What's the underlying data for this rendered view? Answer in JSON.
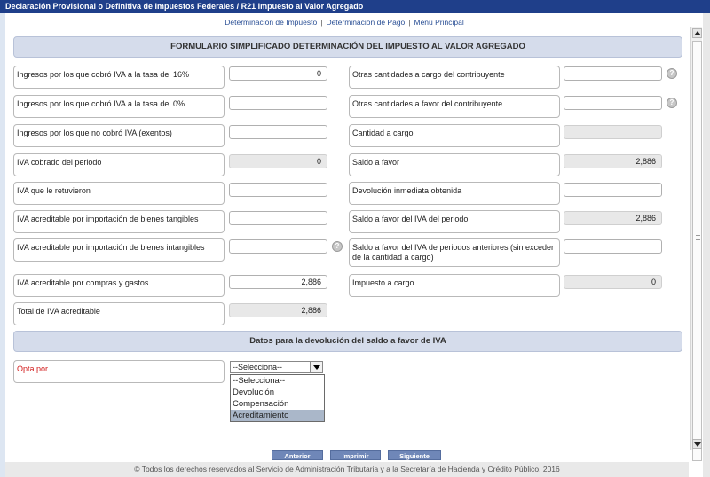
{
  "window": {
    "title": "Declaración Provisional o Definitiva de Impuestos Federales / R21 Impuesto al Valor Agregado"
  },
  "nav": {
    "items": [
      "Determinación de Impuesto",
      "Determinación de Pago",
      "Menú Principal"
    ],
    "separator": "|"
  },
  "form": {
    "header": "FORMULARIO SIMPLIFICADO DETERMINACIÓN DEL IMPUESTO AL VALOR AGREGADO",
    "left": [
      {
        "label": "Ingresos por los que cobró IVA a la tasa del 16%",
        "value": "0",
        "readonly": false,
        "help": false
      },
      {
        "label": "Ingresos por los que cobró IVA a la tasa del 0%",
        "value": "",
        "readonly": false,
        "help": false
      },
      {
        "label": "Ingresos por los que no cobró IVA (exentos)",
        "value": "",
        "readonly": false,
        "help": false
      },
      {
        "label": "IVA cobrado del periodo",
        "value": "0",
        "readonly": true,
        "help": false
      },
      {
        "label": "IVA que le retuvieron",
        "value": "",
        "readonly": false,
        "help": false
      },
      {
        "label": "IVA acreditable por importación de bienes tangibles",
        "value": "",
        "readonly": false,
        "help": false
      },
      {
        "label": "IVA acreditable por importación de bienes intangibles",
        "value": "",
        "readonly": false,
        "help": true
      },
      {
        "label": "IVA acreditable por compras y gastos",
        "value": "2,886",
        "readonly": false,
        "help": false
      },
      {
        "label": "Total de IVA acreditable",
        "value": "2,886",
        "readonly": true,
        "help": false
      }
    ],
    "right": [
      {
        "label": "Otras cantidades a cargo del contribuyente",
        "value": "",
        "readonly": false,
        "help": true
      },
      {
        "label": "Otras cantidades a favor del contribuyente",
        "value": "",
        "readonly": false,
        "help": true
      },
      {
        "label": "Cantidad a cargo",
        "value": "",
        "readonly": true,
        "help": false
      },
      {
        "label": "Saldo a favor",
        "value": "2,886",
        "readonly": true,
        "help": false
      },
      {
        "label": "Devolución inmediata obtenida",
        "value": "",
        "readonly": false,
        "help": false
      },
      {
        "label": "Saldo a favor del IVA del periodo",
        "value": "2,886",
        "readonly": true,
        "help": false
      },
      {
        "label": "Saldo a favor del IVA de periodos anteriores (sin exceder de la cantidad a cargo)",
        "value": "",
        "readonly": false,
        "help": false
      },
      {
        "label": "Impuesto a cargo",
        "value": "0",
        "readonly": true,
        "help": false
      }
    ]
  },
  "refund": {
    "header": "Datos para la devolución del saldo a favor de IVA",
    "opt_label": "Opta por",
    "select_value": "--Selecciona--",
    "options": [
      "--Selecciona--",
      "Devolución",
      "Compensación",
      "Acreditamiento"
    ],
    "highlighted_option": 3
  },
  "help_glyph": "?",
  "buttons": {
    "prev": "Anterior",
    "print": "Imprimir",
    "next": "Siguiente"
  },
  "footer": "© Todos los derechos reservados al Servicio de Administración Tributaria y a la Secretaría de Hacienda y Crédito Público. 2016",
  "colors": {
    "titlebar": "#1f3f8a",
    "section": "#d5dceb",
    "button": "#6f87b8",
    "required_label": "#d21c1c"
  }
}
